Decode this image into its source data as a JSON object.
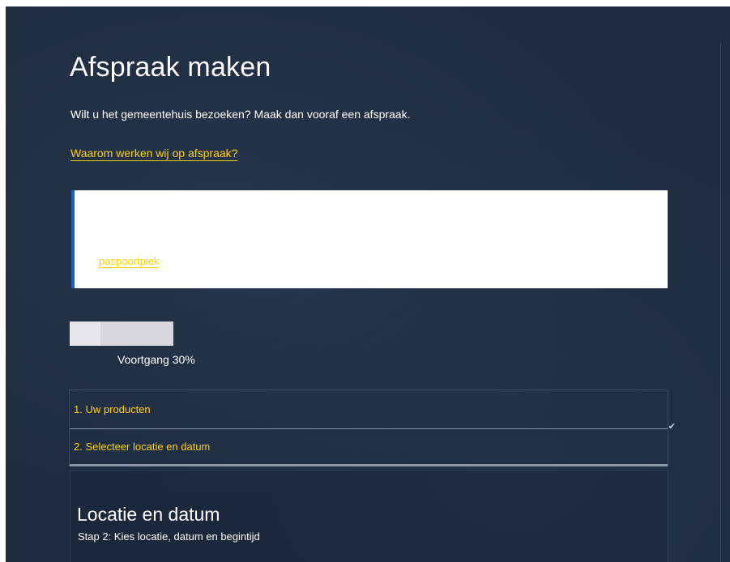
{
  "page": {
    "title": "Afspraak maken",
    "intro": "Wilt u het gemeentehuis bezoeken? Maak dan vooraf een afspraak.",
    "why_link": "Waarom werken wij op afspraak?"
  },
  "notice": {
    "link_text": "paspoortpiek"
  },
  "progress": {
    "value": 0.3,
    "label": "Voortgang 30%"
  },
  "steps": [
    {
      "label": "1. Uw producten",
      "completed": true
    },
    {
      "label": "2. Selecteer locatie en datum",
      "completed": false
    }
  ],
  "panel": {
    "title": "Locatie en datum",
    "subtitle": "Stap 2: Kies locatie, datum en begintijd"
  },
  "colors": {
    "background": "#1f2c40",
    "link": "#ffd200",
    "notice_accent": "#1565c0"
  },
  "icons": {
    "step_complete": "check-icon"
  }
}
